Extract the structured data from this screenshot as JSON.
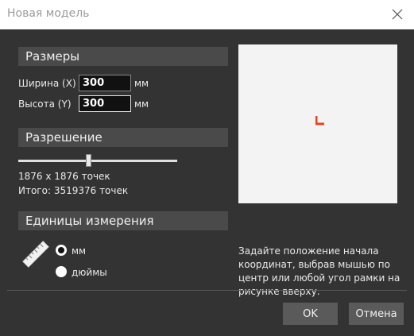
{
  "window": {
    "title": "Новая модель"
  },
  "sizes": {
    "header": "Размеры",
    "width_label": "Ширина (X)",
    "width_value": "300",
    "height_label": "Высота (Y)",
    "height_value": "300",
    "unit": "мм"
  },
  "resolution": {
    "header": "Разрешение",
    "slider_fraction": 0.44,
    "points_text": "1876 x 1876 точек",
    "total_text": "Итого: 3519376 точек"
  },
  "units": {
    "header": "Единицы измерения",
    "options": [
      {
        "label": "мм",
        "checked": true
      },
      {
        "label": "дюймы",
        "checked": false
      }
    ],
    "icon": "ruler-icon"
  },
  "preview": {
    "hint": "Задайте положение начала координат, выбрав мышью по центр или любой угол рамки на рисунке вверху.",
    "origin_marker_color": "#e8431b",
    "origin_icon": "origin-corner-icon"
  },
  "buttons": {
    "ok": "OK",
    "cancel": "Отмена"
  },
  "colors": {
    "dialog_bg": "#333333",
    "header_bg": "#4a4a4a",
    "button_bg": "#5a5a5a"
  }
}
